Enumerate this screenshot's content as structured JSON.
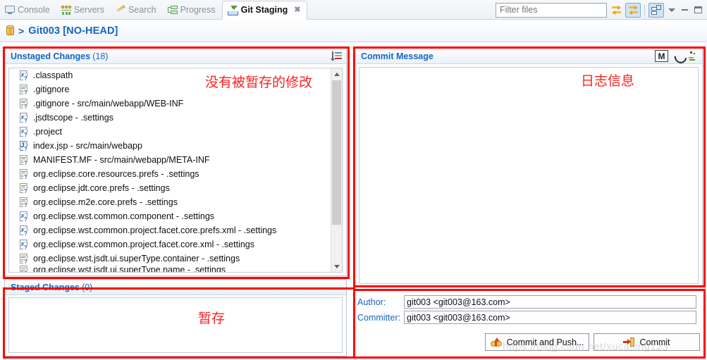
{
  "tabs": [
    {
      "label": "Console",
      "icon": "console-icon",
      "active": false
    },
    {
      "label": "Servers",
      "icon": "servers-icon",
      "active": false
    },
    {
      "label": "Search",
      "icon": "search-pen-icon",
      "active": false
    },
    {
      "label": "Progress",
      "icon": "progress-icon",
      "active": false
    },
    {
      "label": "Git Staging",
      "icon": "git-staging-icon",
      "active": true,
      "close": "✖"
    }
  ],
  "toolbar": {
    "filter_placeholder": "Filter files",
    "filter_value": "",
    "buttons": [
      {
        "name": "refresh-swap-icon",
        "pressed": false
      },
      {
        "name": "link-selection-icon",
        "pressed": true
      },
      {
        "name": "column-layout-icon",
        "pressed": true
      }
    ],
    "window": [
      {
        "name": "view-menu-chevron-icon"
      },
      {
        "name": "minimize-icon"
      },
      {
        "name": "maximize-icon"
      }
    ]
  },
  "breadcrumb": {
    "repo_icon": "repository-icon",
    "separator": ">",
    "title": "Git003 [NO-HEAD]"
  },
  "unstaged": {
    "title": "Unstaged Changes",
    "count": "(18)",
    "sort_icon": "sort-presentation-icon",
    "files": [
      {
        "name": ".classpath",
        "type": "xml"
      },
      {
        "name": ".gitignore",
        "type": "doc"
      },
      {
        "name": ".gitignore - src/main/webapp/WEB-INF",
        "type": "doc"
      },
      {
        "name": ".jsdtscope - .settings",
        "type": "xml"
      },
      {
        "name": ".project",
        "type": "xml"
      },
      {
        "name": "index.jsp - src/main/webapp",
        "type": "jsp"
      },
      {
        "name": "MANIFEST.MF - src/main/webapp/META-INF",
        "type": "doc"
      },
      {
        "name": "org.eclipse.core.resources.prefs - .settings",
        "type": "doc"
      },
      {
        "name": "org.eclipse.jdt.core.prefs - .settings",
        "type": "doc"
      },
      {
        "name": "org.eclipse.m2e.core.prefs - .settings",
        "type": "doc"
      },
      {
        "name": "org.eclipse.wst.common.component - .settings",
        "type": "xml"
      },
      {
        "name": "org.eclipse.wst.common.project.facet.core.prefs.xml - .settings",
        "type": "xml"
      },
      {
        "name": "org.eclipse.wst.common.project.facet.core.xml - .settings",
        "type": "xml"
      },
      {
        "name": "org.eclipse.wst.jsdt.ui.superType.container - .settings",
        "type": "doc"
      },
      {
        "name": "org.eclipse.wst.jsdt.ui.superType.name - .settings",
        "type": "doc"
      }
    ],
    "annotation": "没有被暂存的修改"
  },
  "staged": {
    "title": "Staged Changes",
    "count": "(0)",
    "files": [],
    "annotation": "暂存"
  },
  "commit_message": {
    "title": "Commit Message",
    "value": "",
    "annotation": "日志信息",
    "buttons": [
      {
        "name": "amend-commit-button",
        "label": "M"
      },
      {
        "name": "signed-off-by-icon",
        "label": ""
      },
      {
        "name": "change-id-icon",
        "label": ""
      }
    ]
  },
  "identity": {
    "author_label": "Author:",
    "author_value": "git003 <git003@163.com>",
    "committer_label": "Committer:",
    "committer_value": "git003 <git003@163.com>"
  },
  "actions": {
    "commit_and_push": "Commit and Push...",
    "commit": "Commit"
  },
  "watermark": "https://blog.csdn.net/xucaiiing123",
  "colors": {
    "accent_blue": "#1764c0",
    "annotation_red": "#ff2020",
    "panel_border": "#b6c2cf"
  }
}
